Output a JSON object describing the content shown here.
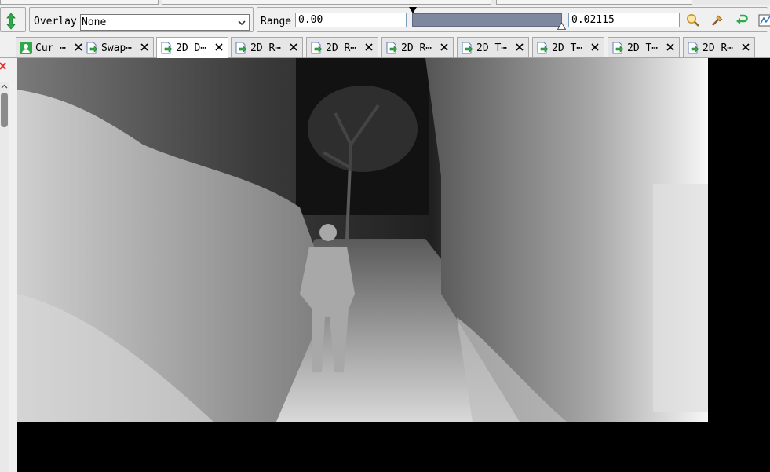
{
  "toolbar": {
    "overlay_label": "Overlay",
    "overlay_value": "None",
    "range_label": "Range",
    "range_min": "0.00",
    "range_max": "0.02115",
    "tools": [
      "zoom-tool-icon",
      "picker-tool-icon",
      "undo-range-icon",
      "histogram-icon"
    ]
  },
  "tabs": [
    {
      "label": "Cur ⋯",
      "icon": "person-icon",
      "active": false
    },
    {
      "label": "Swap⋯",
      "icon": "texture-arrow-icon",
      "active": false
    },
    {
      "label": "2D D⋯",
      "icon": "texture-arrow-icon",
      "active": true
    },
    {
      "label": "2D R⋯",
      "icon": "texture-arrow-icon",
      "active": false
    },
    {
      "label": "2D R⋯",
      "icon": "texture-arrow-icon",
      "active": false
    },
    {
      "label": "2D R⋯",
      "icon": "texture-arrow-icon",
      "active": false
    },
    {
      "label": "2D T⋯",
      "icon": "texture-arrow-icon",
      "active": false
    },
    {
      "label": "2D T⋯",
      "icon": "texture-arrow-icon",
      "active": false
    },
    {
      "label": "2D T⋯",
      "icon": "texture-arrow-icon",
      "active": false
    },
    {
      "label": "2D R⋯",
      "icon": "texture-arrow-icon",
      "active": false
    }
  ],
  "colors": {
    "accent_green": "#2da84a",
    "slider_track": "#7d879d",
    "viewer_bg": "#000000"
  }
}
